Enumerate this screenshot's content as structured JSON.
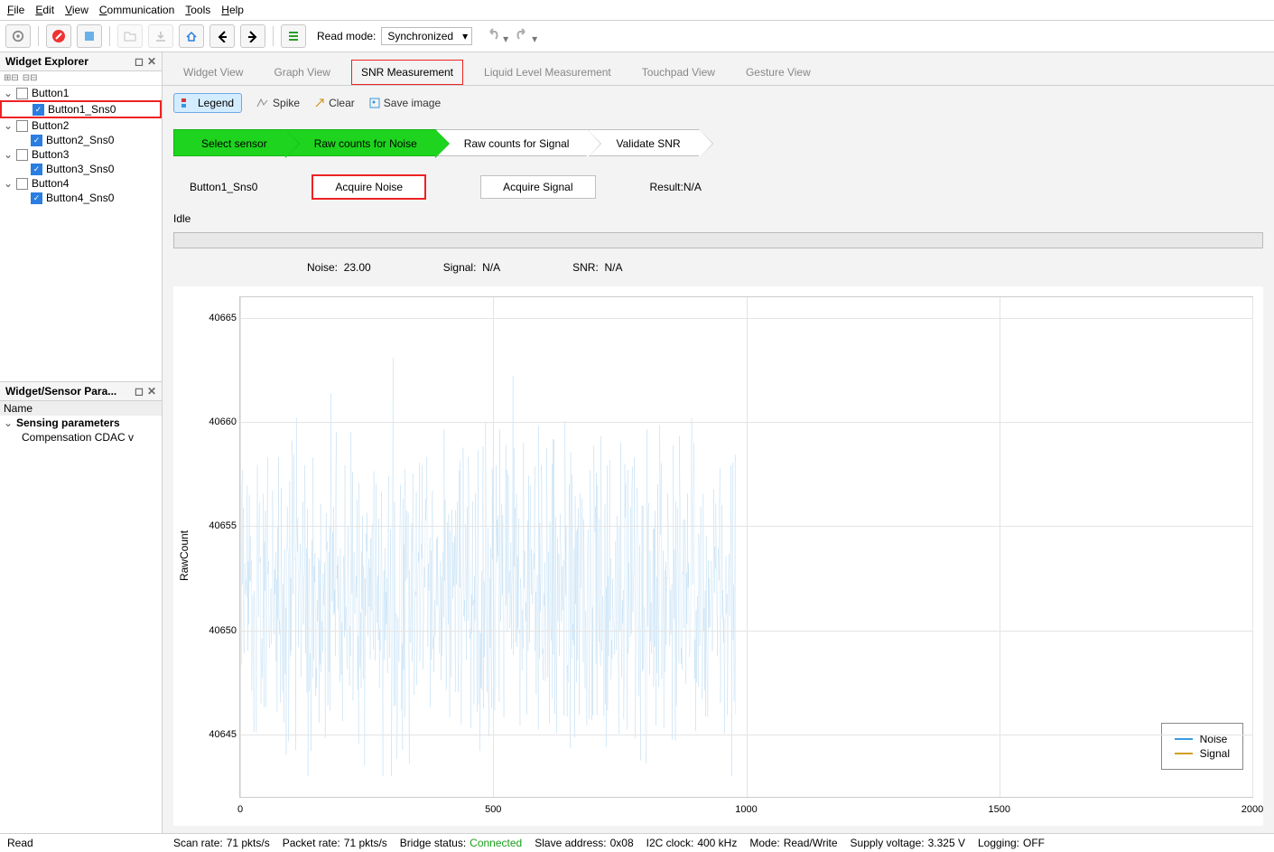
{
  "menubar": [
    "File",
    "Edit",
    "View",
    "Communication",
    "Tools",
    "Help"
  ],
  "toolbar": {
    "readmode_label": "Read mode:",
    "readmode_value": "Synchronized"
  },
  "widget_explorer": {
    "title": "Widget Explorer",
    "items": [
      {
        "name": "Button1",
        "checked": false,
        "children": [
          {
            "name": "Button1_Sns0",
            "checked": true,
            "highlight": true
          }
        ]
      },
      {
        "name": "Button2",
        "checked": false,
        "children": [
          {
            "name": "Button2_Sns0",
            "checked": true
          }
        ]
      },
      {
        "name": "Button3",
        "checked": false,
        "children": [
          {
            "name": "Button3_Sns0",
            "checked": true
          }
        ]
      },
      {
        "name": "Button4",
        "checked": false,
        "children": [
          {
            "name": "Button4_Sns0",
            "checked": true
          }
        ]
      }
    ]
  },
  "sensor_params": {
    "title": "Widget/Sensor Para...",
    "name_header": "Name",
    "rows": [
      "Sensing parameters",
      "Compensation CDAC v"
    ]
  },
  "tabs": [
    "Widget View",
    "Graph View",
    "SNR Measurement",
    "Liquid Level Measurement",
    "Touchpad View",
    "Gesture View"
  ],
  "active_tab": "SNR Measurement",
  "subtoolbar": {
    "legend": "Legend",
    "spike": "Spike",
    "clear": "Clear",
    "save": "Save image"
  },
  "steps": [
    "Select sensor",
    "Raw counts for Noise",
    "Raw counts for Signal",
    "Validate SNR"
  ],
  "ctrl": {
    "sensor": "Button1_Sns0",
    "acquire_noise": "Acquire Noise",
    "acquire_signal": "Acquire Signal",
    "result_label": "Result:",
    "result_value": "N/A"
  },
  "idle": "Idle",
  "metrics": {
    "noise_label": "Noise:",
    "noise_val": "23.00",
    "signal_label": "Signal:",
    "signal_val": "N/A",
    "snr_label": "SNR:",
    "snr_val": "N/A"
  },
  "chart_data": {
    "type": "line",
    "ylabel": "RawCount",
    "xlim": [
      0,
      2000
    ],
    "ylim": [
      40642,
      40666
    ],
    "xticks": [
      0,
      500,
      1000,
      1500,
      2000
    ],
    "yticks": [
      40645,
      40650,
      40655,
      40660,
      40665
    ],
    "series": [
      {
        "name": "Noise",
        "color": "#3a9bdc",
        "n": 980,
        "mean": 40651.5,
        "min": 40643,
        "max": 40665,
        "spread": 4.5
      },
      {
        "name": "Signal",
        "color": "#d4a020",
        "n": 0
      }
    ]
  },
  "statusbar": {
    "read": "Read",
    "scan_rate_label": "Scan rate:",
    "scan_rate": "71 pkts/s",
    "packet_rate_label": "Packet rate:",
    "packet_rate": "71 pkts/s",
    "bridge_label": "Bridge status:",
    "bridge": "Connected",
    "slave_label": "Slave address:",
    "slave": "0x08",
    "i2c_label": "I2C clock:",
    "i2c": "400 kHz",
    "mode_label": "Mode:",
    "mode": "Read/Write",
    "supply_label": "Supply voltage:",
    "supply": "3.325 V",
    "log_label": "Logging:",
    "log": "OFF"
  }
}
